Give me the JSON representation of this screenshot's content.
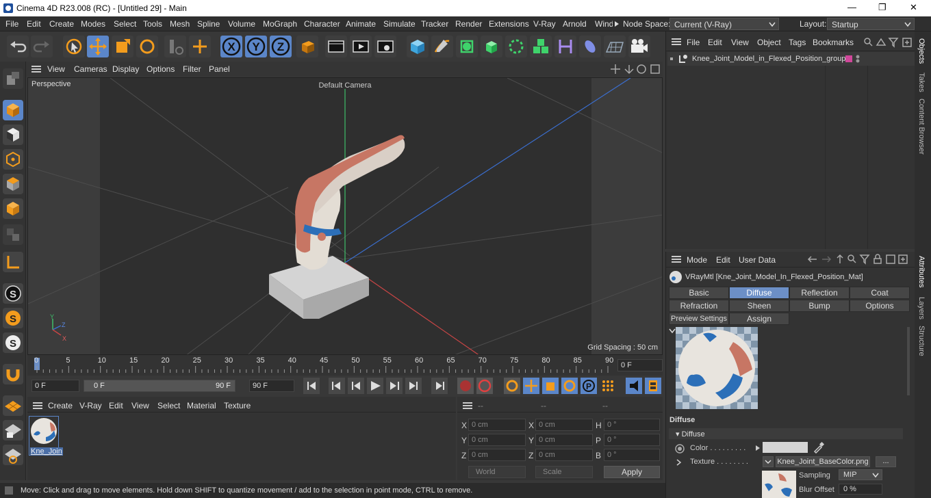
{
  "titlebar": {
    "title": "Cinema 4D R23.008 (RC) - [Untitled 29] - Main",
    "minimize": "—",
    "maximize": "❐",
    "close": "✕"
  },
  "menubar": {
    "items": [
      "File",
      "Edit",
      "Create",
      "Modes",
      "Select",
      "Tools",
      "Mesh",
      "Spline",
      "Volume",
      "MoGraph",
      "Character",
      "Animate",
      "Simulate",
      "Tracker",
      "Render",
      "Extensions",
      "V-Ray",
      "Arnold",
      "Wind"
    ],
    "node_space_label": "Node Space:",
    "node_space_value": "Current (V-Ray)",
    "layout_label": "Layout:",
    "layout_value": "Startup"
  },
  "viewport": {
    "menu": [
      "View",
      "Cameras",
      "Display",
      "Options",
      "Filter",
      "Panel"
    ],
    "view_name": "Perspective",
    "camera": "Default Camera",
    "grid_spacing": "Grid Spacing : 50 cm",
    "axis_y": "Y",
    "axis_z": "Z",
    "axis_x": "X"
  },
  "timeline": {
    "ticks": [
      "0",
      "5",
      "10",
      "15",
      "20",
      "25",
      "30",
      "35",
      "40",
      "45",
      "50",
      "55",
      "60",
      "65",
      "70",
      "75",
      "80",
      "85",
      "90"
    ],
    "current_frame": "0 F"
  },
  "transport": {
    "start": "0 F",
    "range_start": "0 F",
    "range_end": "90 F",
    "end": "90 F"
  },
  "material_manager": {
    "menu": [
      "Create",
      "V-Ray",
      "Edit",
      "View",
      "Select",
      "Material",
      "Texture"
    ],
    "material_name": "Kne_Join"
  },
  "coordinates": {
    "headers": [
      "--",
      "--",
      "--"
    ],
    "rows": [
      {
        "a": "X",
        "av": "0 cm",
        "b": "X",
        "bv": "0 cm",
        "c": "H",
        "cv": "0 °"
      },
      {
        "a": "Y",
        "av": "0 cm",
        "b": "Y",
        "bv": "0 cm",
        "c": "P",
        "cv": "0 °"
      },
      {
        "a": "Z",
        "av": "0 cm",
        "b": "Z",
        "bv": "0 cm",
        "c": "B",
        "cv": "0 °"
      }
    ],
    "world": "World",
    "scale": "Scale",
    "apply": "Apply"
  },
  "statusbar": {
    "text": "Move: Click and drag to move elements. Hold down SHIFT to quantize movement / add to the selection in point mode, CTRL to remove."
  },
  "object_manager": {
    "menu": [
      "File",
      "Edit",
      "View",
      "Object",
      "Tags",
      "Bookmarks"
    ],
    "object_name": "Knee_Joint_Model_in_Flexed_Position_group"
  },
  "attribute_manager": {
    "menu": [
      "Mode",
      "Edit",
      "User Data"
    ],
    "material_title": "VRayMtl [Kne_Joint_Model_In_Flexed_Position_Mat]",
    "tabs_row1": [
      "Basic",
      "Diffuse",
      "Reflection",
      "Coat"
    ],
    "tabs_row2": [
      "Refraction",
      "Sheen",
      "Bump",
      "Options"
    ],
    "tabs_row3": [
      "Preview Settings",
      "Assign"
    ],
    "section": "Diffuse",
    "group": "▾ Diffuse",
    "color_label": "Color . . . . . . . . .",
    "texture_label": "Texture . . . . . . . .",
    "texture_file": "Knee_Joint_BaseColor.png",
    "more": "...",
    "sampling_label": "Sampling",
    "sampling_value": "MIP",
    "blur_label": "Blur Offset",
    "blur_value": "0 %"
  },
  "side_tabs": [
    "Objects",
    "Takes",
    "Content Browser",
    "Attributes",
    "Layers",
    "Structure"
  ],
  "colors": {
    "accent": "#5b86c9",
    "tab_selected": "#6c8fc6",
    "object_tag": "#d0479a"
  }
}
